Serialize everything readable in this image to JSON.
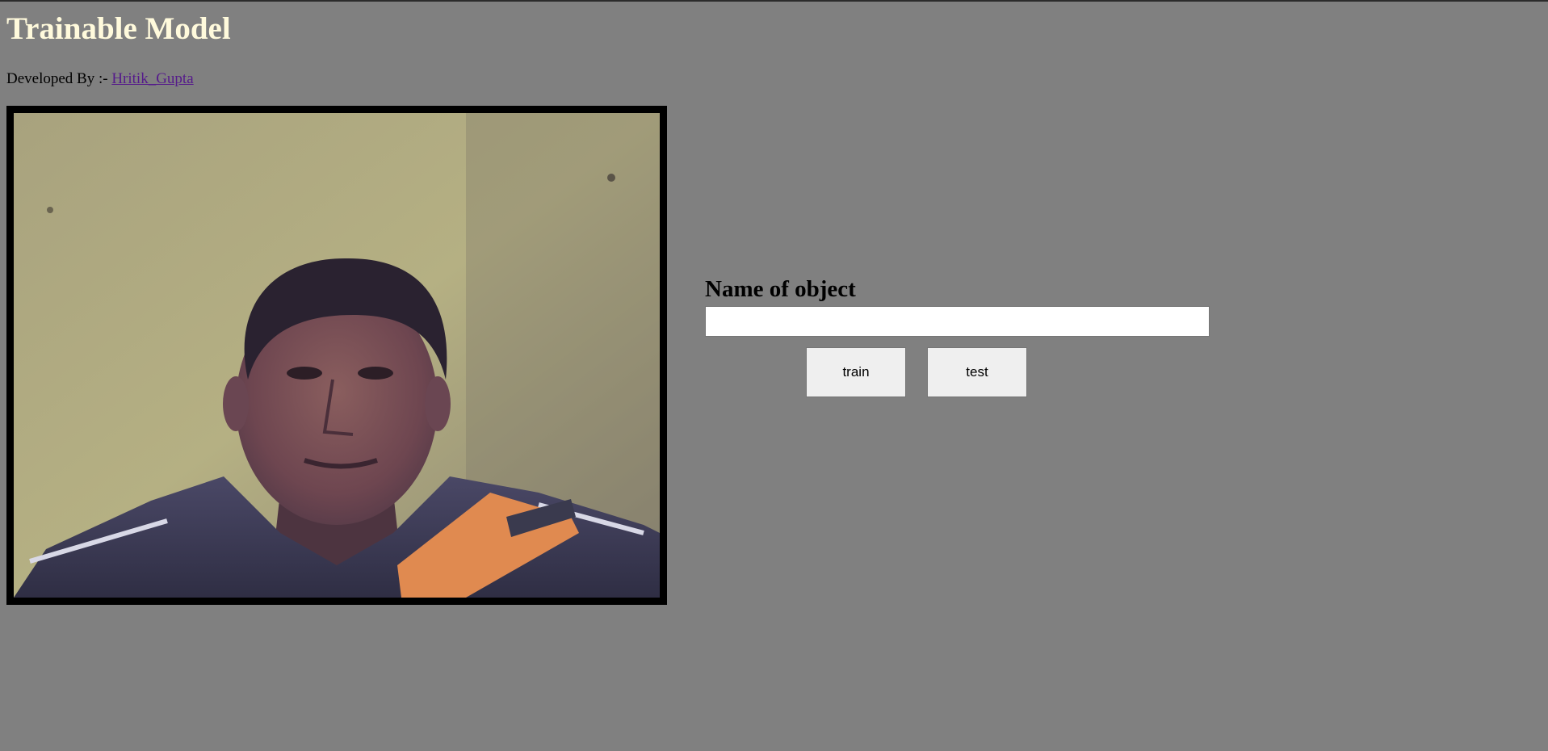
{
  "header": {
    "title": "Trainable Model",
    "credit_prefix": "Developed By :- ",
    "author_link": "Hritik_Gupta"
  },
  "form": {
    "label": "Name of object",
    "input_value": "",
    "input_placeholder": "",
    "train_label": "train",
    "test_label": "test"
  },
  "colors": {
    "page_background": "#808080",
    "title_color": "#fffadc",
    "link_color": "#551a8b",
    "button_background": "#efefef"
  }
}
